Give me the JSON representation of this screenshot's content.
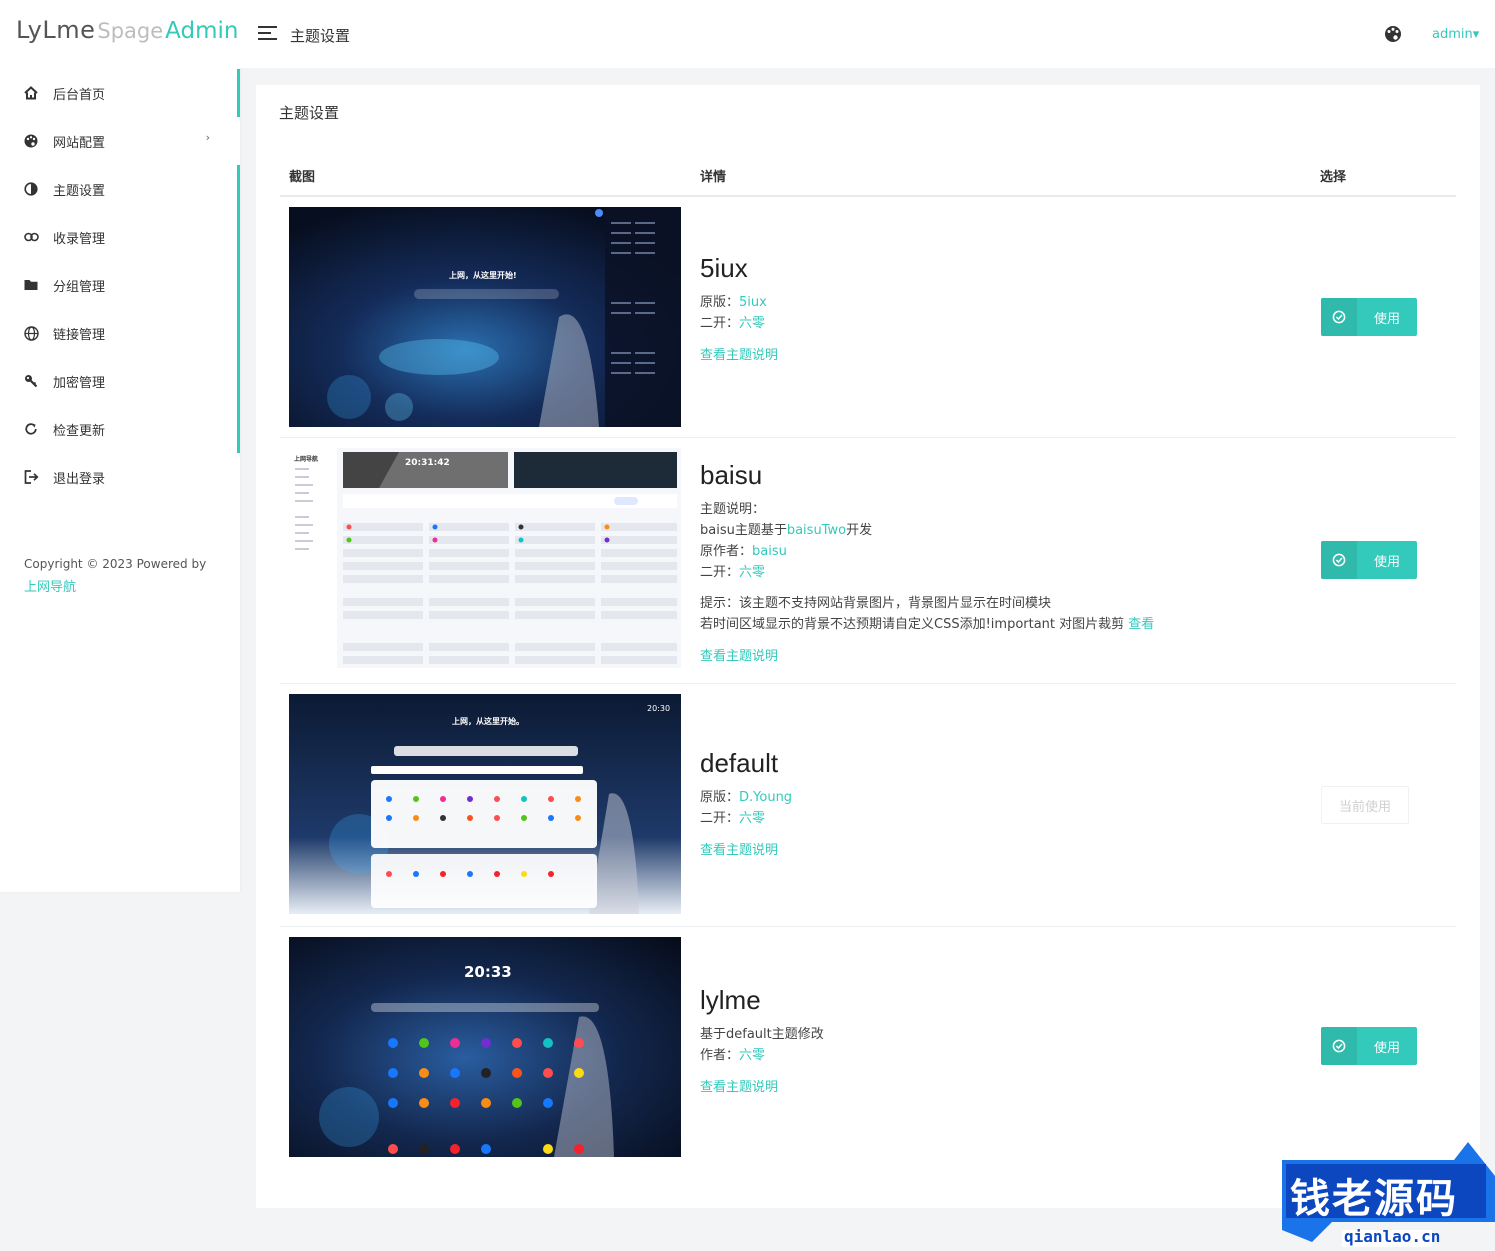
{
  "logo": {
    "part1": "LyLme",
    "part2": "Spage",
    "part3": "Admin"
  },
  "sidebar": {
    "items": [
      {
        "label": "后台首页",
        "icon": "home-icon"
      },
      {
        "label": "网站配置",
        "icon": "palette-icon",
        "has_submenu": true
      },
      {
        "label": "主题设置",
        "icon": "contrast-icon"
      },
      {
        "label": "收录管理",
        "icon": "link-icon"
      },
      {
        "label": "分组管理",
        "icon": "folder-icon"
      },
      {
        "label": "链接管理",
        "icon": "globe-icon"
      },
      {
        "label": "加密管理",
        "icon": "key-icon"
      },
      {
        "label": "检查更新",
        "icon": "refresh-icon"
      },
      {
        "label": "退出登录",
        "icon": "logout-icon"
      }
    ],
    "caret": "›",
    "copyright": "Copyright © 2023 Powered by",
    "copyright_link": "上网导航"
  },
  "header": {
    "title": "主题设置",
    "user": "admin▾"
  },
  "main": {
    "title": "主题设置",
    "columns": {
      "screenshot": "截图",
      "details": "详情",
      "select": "选择"
    },
    "themes": [
      {
        "name": "5iux",
        "lines": [
          {
            "label": "原版：",
            "link": "5iux"
          },
          {
            "label": "二开：",
            "link": "六零"
          }
        ],
        "doc_link": "查看主题说明",
        "action": "使用",
        "thumb_text": "上网，从这里开始!"
      },
      {
        "name": "baisu",
        "desc_label": "主题说明：",
        "desc_pre": "baisu主题基于",
        "desc_link": "baisuTwo",
        "desc_post": "开发",
        "lines": [
          {
            "label": "原作者：",
            "link": "baisu"
          },
          {
            "label": "二开：",
            "link": "六零"
          }
        ],
        "tip1": "提示：该主题不支持网站背景图片，背景图片显示在时间模块",
        "tip2": "若时间区域显示的背景不达预期请自定义CSS添加!important 对图片裁剪",
        "tip_link": "查看",
        "doc_link": "查看主题说明",
        "action": "使用",
        "thumb_text": "20:31:42",
        "thumb_side": "上网导航"
      },
      {
        "name": "default",
        "lines": [
          {
            "label": "原版：",
            "link": "D.Young"
          },
          {
            "label": "二开：",
            "link": "六零"
          }
        ],
        "doc_link": "查看主题说明",
        "action": "当前使用",
        "thumb_text": "上网，从这里开始。",
        "thumb_time": "20:30"
      },
      {
        "name": "lylme",
        "desc": "基于default主题修改",
        "lines": [
          {
            "label": "作者：",
            "link": "六零"
          }
        ],
        "doc_link": "查看主题说明",
        "action": "使用",
        "thumb_text": "20:33"
      }
    ]
  },
  "watermark": {
    "title": "钱老源码",
    "url": "qianlao.cn"
  },
  "colors": {
    "accent": "#33cabb",
    "dark_bg": "#0f1d3a"
  }
}
